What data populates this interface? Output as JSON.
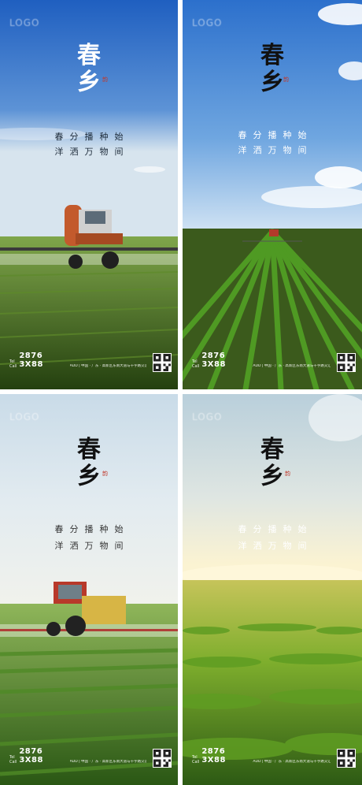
{
  "posters": [
    {
      "logo": "LOGO",
      "title_char1": "春",
      "title_char2": "乡",
      "seal": "韵",
      "line1": "春分播种始",
      "line2": "洋洒万物间",
      "tel_label": "Tel\nCall",
      "tel": "2876 3X88",
      "address": "ADD | 中国 · 广东 · 高新区东南大道与十字路交汇口"
    },
    {
      "logo": "LOGO",
      "title_char1": "春",
      "title_char2": "乡",
      "seal": "韵",
      "line1": "春分播种始",
      "line2": "洋洒万物间",
      "tel_label": "Tel\nCall",
      "tel": "2876 3X88",
      "address": "ADD | 中国 · 广东 · 高新区东南大道与十字路交汇口"
    },
    {
      "logo": "LOGO",
      "title_char1": "春",
      "title_char2": "乡",
      "seal": "韵",
      "line1": "春分播种始",
      "line2": "洋洒万物间",
      "tel_label": "Tel\nCall",
      "tel": "2876 3X88",
      "address": "ADD | 中国 · 广东 · 高新区东南大道与十字路交汇口"
    },
    {
      "logo": "LOGO",
      "title_char1": "春",
      "title_char2": "乡",
      "seal": "韵",
      "line1": "春分播种始",
      "line2": "洋洒万物间",
      "tel_label": "Tel\nCall",
      "tel": "2876 3X88",
      "address": "ADD | 中国 · 广东 · 高新区东南大道与十字路交汇口"
    }
  ],
  "colors": {
    "title_light": "#ffffff",
    "title_dark": "#111111",
    "seal_red": "#c0392b",
    "sky_blue": "#2f6fc4",
    "crop_green": "#3d7a1f"
  }
}
